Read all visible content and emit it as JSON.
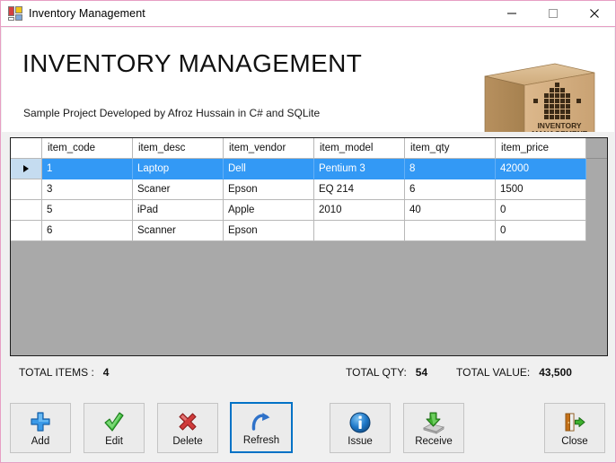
{
  "window": {
    "title": "Inventory Management",
    "icon": "winforms-app-icon",
    "controls": [
      {
        "name": "minimize",
        "glyph": "minimize-icon"
      },
      {
        "name": "maximize",
        "glyph": "maximize-icon"
      },
      {
        "name": "close",
        "glyph": "close-icon"
      }
    ],
    "border_color": "#e79fc4"
  },
  "header": {
    "title": "INVENTORY MANAGEMENT",
    "subtitle": "Sample Project Developed by Afroz Hussain in C# and SQLite",
    "logo": {
      "name": "cardboard-box-logo",
      "line1": "INVENTORY",
      "line2": "MANAGEMENT",
      "box_color": "#d8b184",
      "arrow_color": "#3b2a16"
    }
  },
  "grid": {
    "columns": [
      "item_code",
      "item_desc",
      "item_vendor",
      "item_model",
      "item_qty",
      "item_price"
    ],
    "selected_row_index": 0,
    "selection_color": "#3399f5",
    "rows": [
      {
        "item_code": "1",
        "item_desc": "Laptop",
        "item_vendor": "Dell",
        "item_model": "Pentium 3",
        "item_qty": "8",
        "item_price": "42000"
      },
      {
        "item_code": "3",
        "item_desc": "Scaner",
        "item_vendor": "Epson",
        "item_model": "EQ 214",
        "item_qty": "6",
        "item_price": "1500"
      },
      {
        "item_code": "5",
        "item_desc": "iPad",
        "item_vendor": "Apple",
        "item_model": "2010",
        "item_qty": "40",
        "item_price": "0"
      },
      {
        "item_code": "6",
        "item_desc": "Scanner",
        "item_vendor": "Epson",
        "item_model": "",
        "item_qty": "",
        "item_price": "0"
      }
    ]
  },
  "totals": {
    "items_label": "TOTAL ITEMS :",
    "items_value": "4",
    "qty_label": "TOTAL QTY:",
    "qty_value": "54",
    "value_label": "TOTAL VALUE:",
    "value_value": "43,500"
  },
  "buttons": [
    {
      "id": "add",
      "label": "Add",
      "icon": "plus-icon",
      "color": "#2c87dd",
      "focused": false
    },
    {
      "id": "edit",
      "label": "Edit",
      "icon": "check-icon",
      "color": "#3fbb3f",
      "focused": false
    },
    {
      "id": "delete",
      "label": "Delete",
      "icon": "cross-icon",
      "color": "#cc3333",
      "focused": false
    },
    {
      "id": "refresh",
      "label": "Refresh",
      "icon": "refresh-arrow-icon",
      "color": "#2c6fd0",
      "focused": true
    },
    {
      "id": "issue",
      "label": "Issue",
      "icon": "info-circle-icon",
      "color": "#1a6fc4",
      "focused": false
    },
    {
      "id": "receive",
      "label": "Receive",
      "icon": "receive-disk-icon",
      "color": "#3aa82e",
      "focused": false
    },
    {
      "id": "close",
      "label": "Close",
      "icon": "exit-door-icon",
      "color": "#d98424",
      "focused": false
    }
  ]
}
